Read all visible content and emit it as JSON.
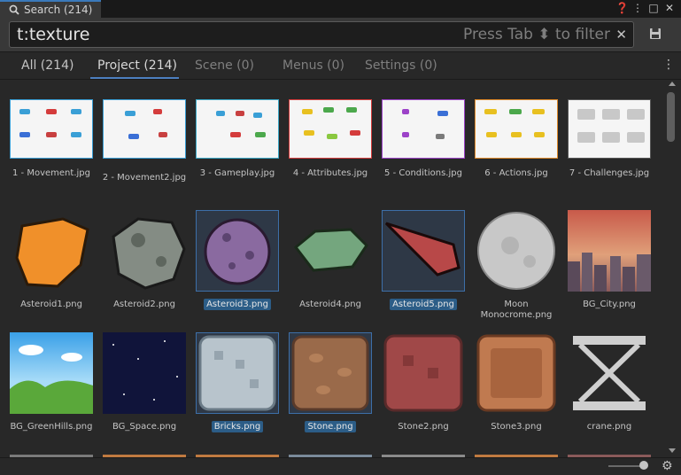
{
  "window": {
    "tab_label": "Search (214)",
    "controls": [
      "help-icon",
      "more-vertical-icon",
      "maximize-icon",
      "close-icon"
    ]
  },
  "search": {
    "query": "t:texture",
    "hint": "Press Tab ⬍ to filter",
    "clear_glyph": "✕",
    "save_icon": "floppy-disk-icon"
  },
  "tabs": [
    {
      "label": "All (214)",
      "state": "normal"
    },
    {
      "label": "Project (214)",
      "state": "active"
    },
    {
      "label": "Scene (0)",
      "state": "dim"
    },
    {
      "label": "Menus (0)",
      "state": "dim"
    },
    {
      "label": "Settings (0)",
      "state": "dim"
    }
  ],
  "rows": [
    [
      {
        "label": "1 - Movement.jpg",
        "selected": false,
        "accent": "#3a9fd6"
      },
      {
        "label": "2 - Movement2.jpg",
        "selected": false,
        "accent": "#3a9fd6"
      },
      {
        "label": "3 - Gameplay.jpg",
        "selected": false,
        "accent": "#3aa8c8"
      },
      {
        "label": "4 - Attributes.jpg",
        "selected": false,
        "accent": "#d43c3c"
      },
      {
        "label": "5 - Conditions.jpg",
        "selected": false,
        "accent": "#9c42c8"
      },
      {
        "label": "6 - Actions.jpg",
        "selected": false,
        "accent": "#e08a2a"
      },
      {
        "label": "7 - Challenges.jpg",
        "selected": false,
        "accent": "#555555"
      }
    ],
    [
      {
        "label": "Asteroid1.png",
        "selected": false
      },
      {
        "label": "Asteroid2.png",
        "selected": false
      },
      {
        "label": "Asteroid3.png",
        "selected": true
      },
      {
        "label": "Asteroid4.png",
        "selected": false
      },
      {
        "label": "Asteroid5.png",
        "selected": true
      },
      {
        "label": "Moon Monocrome.png",
        "selected": false
      },
      {
        "label": "BG_City.png",
        "selected": false
      }
    ],
    [
      {
        "label": "BG_GreenHills.png",
        "selected": false
      },
      {
        "label": "BG_Space.png",
        "selected": false
      },
      {
        "label": "Bricks.png",
        "selected": true
      },
      {
        "label": "Stone.png",
        "selected": true
      },
      {
        "label": "Stone2.png",
        "selected": false
      },
      {
        "label": "Stone3.png",
        "selected": false
      },
      {
        "label": "crane.png",
        "selected": false
      }
    ]
  ],
  "colors": {
    "accent_blue": "#4c7fc0",
    "selection": "#2c5d87",
    "panel_bg": "#282828"
  },
  "statusbar": {
    "zoom_level": 0.88,
    "settings_icon": "gear-icon"
  }
}
